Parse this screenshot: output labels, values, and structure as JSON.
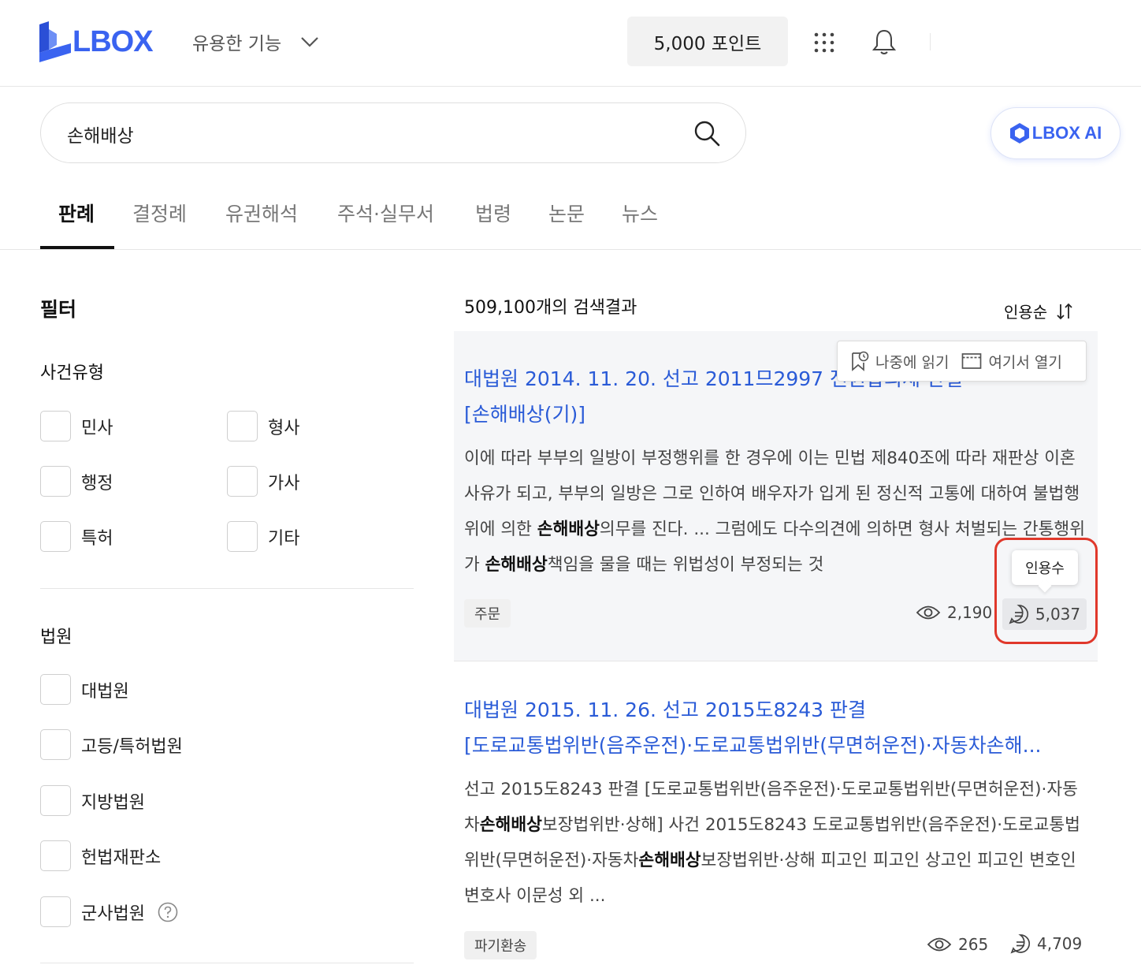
{
  "header": {
    "logo_text": "LBOX",
    "features_label": "유용한 기능",
    "points_label": "5,000 포인트"
  },
  "search": {
    "value": "손해배상"
  },
  "ai_button": {
    "label": "LBOX AI"
  },
  "tabs": [
    {
      "label": "판례",
      "active": true
    },
    {
      "label": "결정례"
    },
    {
      "label": "유권해석"
    },
    {
      "label": "주석·실무서"
    },
    {
      "label": "법령"
    },
    {
      "label": "논문"
    },
    {
      "label": "뉴스"
    }
  ],
  "filter": {
    "title": "필터",
    "case_type": {
      "title": "사건유형",
      "options": [
        "민사",
        "형사",
        "행정",
        "가사",
        "특허",
        "기타"
      ]
    },
    "court": {
      "title": "법원",
      "options": [
        "대법원",
        "고등/특허법원",
        "지방법원",
        "헌법재판소",
        "군사법원"
      ]
    }
  },
  "results": {
    "count_text": "509,100개의 검색결과",
    "sort_label": "인용순",
    "items": [
      {
        "title_line1": "대법원 2014. 11. 20. 선고 2011므2997 전원합의체 판결",
        "title_line2": "[손해배상(기)]",
        "body_1": "이에 따라 부부의 일방이 부정행위를 한 경우에 이는 민법 제840조에 따라 재판상 이혼사유가 되고, 부부의 일방은 그로 인하여 배우자가 입게 된 정신적 고통에 대하여 불법행위에 의한 ",
        "body_bold_1": "손해배상",
        "body_2": "의무를 진다. ... 그럼에도 다수의견에 의하면 형사 처벌되는 간통행위가 ",
        "body_bold_2": "손해배상",
        "body_3": "책임을 물을 때는 위법성이 부정되는 것",
        "tag": "주문",
        "views": "2,190",
        "citations": "5,037"
      },
      {
        "title_line1": "대법원 2015. 11. 26. 선고 2015도8243 판결",
        "title_line2": "[도로교통법위반(음주운전)·도로교통법위반(무면허운전)·자동차손해...",
        "body_1": "선고 2015도8243 판결 [도로교통법위반(음주운전)·도로교통법위반(무면허운전)·자동차",
        "body_bold_1": "손해배상",
        "body_2": "보장법위반·상해] 사건 2015도8243 도로교통법위반(음주운전)·도로교통법위반(무면허운전)·자동차",
        "body_bold_2": "손해배상",
        "body_3": "보장법위반·상해 피고인 피고인 상고인 피고인 변호인 변호사 이문성 외 ...",
        "tag": "파기환송",
        "views": "265",
        "citations": "4,709"
      }
    ]
  },
  "popover": {
    "read_later": "나중에 읽기",
    "open_here": "여기서 열기"
  },
  "tooltip": {
    "text": "인용수"
  },
  "colors": {
    "brand": "#3a63f0",
    "link": "#2a5bd7",
    "highlight": "#e0382b"
  }
}
